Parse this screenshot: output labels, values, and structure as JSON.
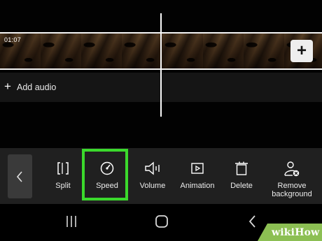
{
  "timeline": {
    "clip_timestamp": "01:07",
    "add_clip_icon": "plus-icon",
    "add_audio_icon": "plus-icon",
    "add_audio_label": "Add audio"
  },
  "toolbar": {
    "back_icon": "chevron-left-icon",
    "tools": [
      {
        "label": "Split",
        "icon": "split-icon"
      },
      {
        "label": "Speed",
        "icon": "speedometer-icon",
        "highlighted": true
      },
      {
        "label": "Volume",
        "icon": "speaker-icon"
      },
      {
        "label": "Animation",
        "icon": "play-box-icon"
      },
      {
        "label": "Delete",
        "icon": "trash-icon"
      },
      {
        "label": "Remove\nbackground",
        "icon": "person-remove-icon"
      }
    ],
    "highlight_color": "#3bd92c"
  },
  "navbar": {
    "recent_icon": "recent-apps-icon",
    "home_icon": "home-icon",
    "back_icon": "back-chevron-icon"
  },
  "watermark": {
    "text": "wikiHow",
    "color": "#8cbf53"
  }
}
